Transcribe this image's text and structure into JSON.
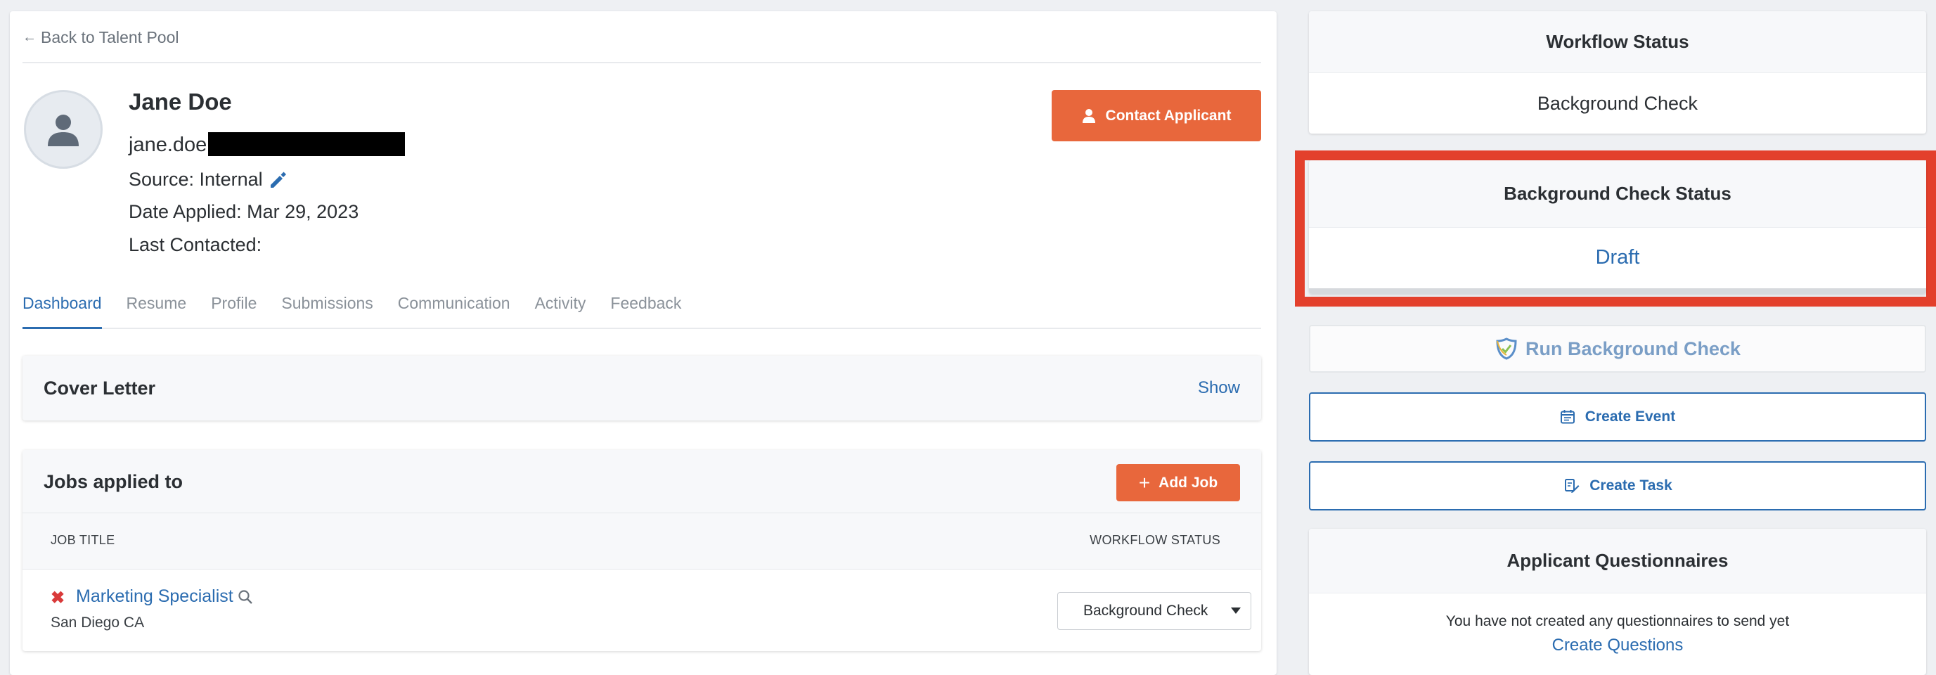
{
  "back_link": "Back to Talent Pool",
  "applicant": {
    "name": "Jane Doe",
    "email_visible": "jane.doe",
    "source_label": "Source: Internal",
    "date_applied": "Date Applied: Mar 29, 2023",
    "last_contacted": "Last Contacted:"
  },
  "contact_button": "Contact Applicant",
  "tabs": [
    "Dashboard",
    "Resume",
    "Profile",
    "Submissions",
    "Communication",
    "Activity",
    "Feedback"
  ],
  "cover_letter": {
    "title": "Cover Letter",
    "action": "Show"
  },
  "jobs": {
    "title": "Jobs applied to",
    "add_button": "Add Job",
    "columns": [
      "JOB TITLE",
      "WORKFLOW STATUS"
    ],
    "rows": [
      {
        "title": "Marketing Specialist",
        "location": "San Diego CA",
        "status": "Background Check"
      }
    ]
  },
  "workflow_status": {
    "title": "Workflow Status",
    "value": "Background Check"
  },
  "background_check_status": {
    "title": "Background Check Status",
    "value": "Draft"
  },
  "run_background_check": "Run Background Check",
  "create_event": "Create Event",
  "create_task": "Create Task",
  "questionnaires": {
    "title": "Applicant Questionnaires",
    "message": "You have not created any questionnaires to send yet",
    "link": "Create Questions"
  },
  "colors": {
    "accent_orange": "#e8673c",
    "link_blue": "#2b6cb0",
    "highlight_red": "#e3402c"
  }
}
